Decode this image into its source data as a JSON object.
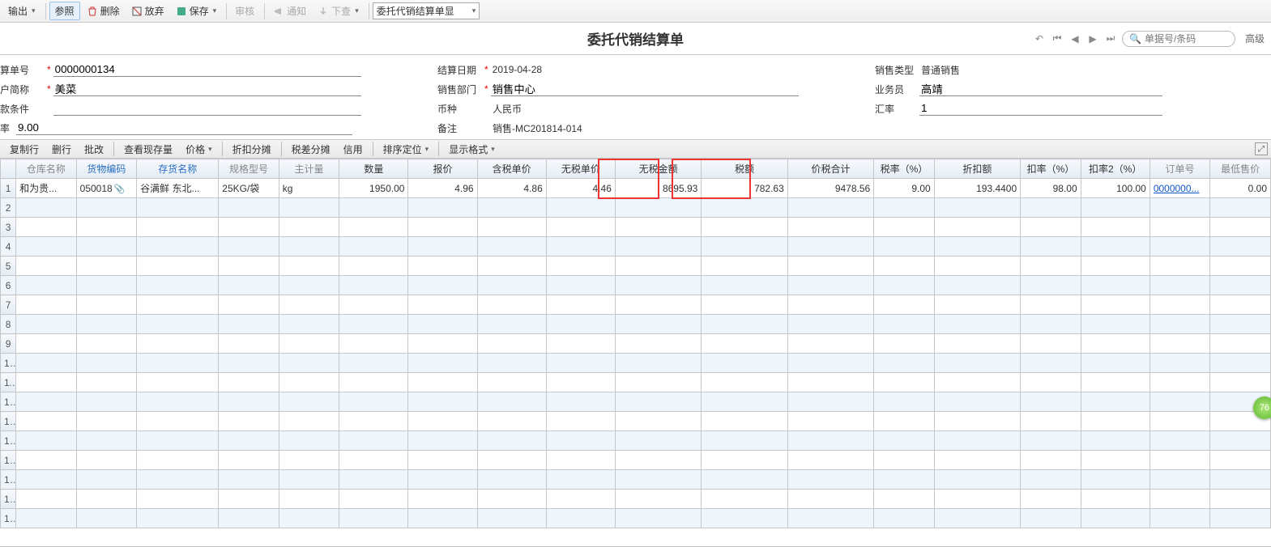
{
  "toolbar": {
    "export_label": "输出",
    "ref_label": "参照",
    "delete_label": "删除",
    "discard_label": "放弃",
    "save_label": "保存",
    "audit_label": "审核",
    "notify_label": "通知",
    "pulldown_label": "下查",
    "mode_combo": "委托代销结算单显"
  },
  "title": "委托代销结算单",
  "search": {
    "placeholder": "单据号/条码",
    "advanced": "高级"
  },
  "form": {
    "order_no": {
      "label": "算单号",
      "value": "0000000134"
    },
    "cust_name": {
      "label": "户简称",
      "value": "美菜"
    },
    "pay_term": {
      "label": "款条件",
      "value": ""
    },
    "rate": {
      "label": "率",
      "value": "9.00"
    },
    "settle_date": {
      "label": "结算日期",
      "value": "2019-04-28"
    },
    "sales_dept": {
      "label": "销售部门",
      "value": "销售中心"
    },
    "currency": {
      "label": "币种",
      "value": "人民币"
    },
    "remark": {
      "label": "备注",
      "value": "销售-MC201814-014"
    },
    "sales_type": {
      "label": "销售类型",
      "value": "普通销售"
    },
    "sales_person": {
      "label": "业务员",
      "value": "高靖"
    },
    "exch_rate": {
      "label": "汇率",
      "value": "1"
    }
  },
  "grid_tb": {
    "copy_row": "复制行",
    "del_row": "删行",
    "batch": "批改",
    "check_stock": "查看现存量",
    "price": "价格",
    "discount": "折扣分摊",
    "taxdiff": "税差分摊",
    "credit": "信用",
    "sort": "排序定位",
    "display": "显示格式"
  },
  "columns": {
    "warehouse": "仓库名称",
    "stock_code": "货物编码",
    "stock_name": "存货名称",
    "spec": "规格型号",
    "main_unit": "主计量",
    "qty": "数量",
    "price": "报价",
    "tax_price": "含税单价",
    "notax_price": "无税单价",
    "notax_amt": "无税金额",
    "tax_amt": "税额",
    "total": "价税合计",
    "tax_rate": "税率（%）",
    "disc_amt": "折扣额",
    "disc_rate": "扣率（%）",
    "disc_rate2": "扣率2（%）",
    "order_ref": "订单号",
    "min_price": "最低售价"
  },
  "row": {
    "warehouse": "和为贵...",
    "stock_code": "050018",
    "stock_name": "谷满鲜 东北...",
    "spec": "25KG/袋",
    "main_unit": "kg",
    "qty": "1950.00",
    "price": "4.96",
    "tax_price": "4.86",
    "notax_price": "4.46",
    "notax_amt": "8695.93",
    "tax_amt": "782.63",
    "total": "9478.56",
    "tax_rate": "9.00",
    "disc_amt": "193.4400",
    "disc_rate": "98.00",
    "disc_rate2": "100.00",
    "order_ref": "0000000...",
    "min_price": "0.00"
  },
  "badge": "76"
}
